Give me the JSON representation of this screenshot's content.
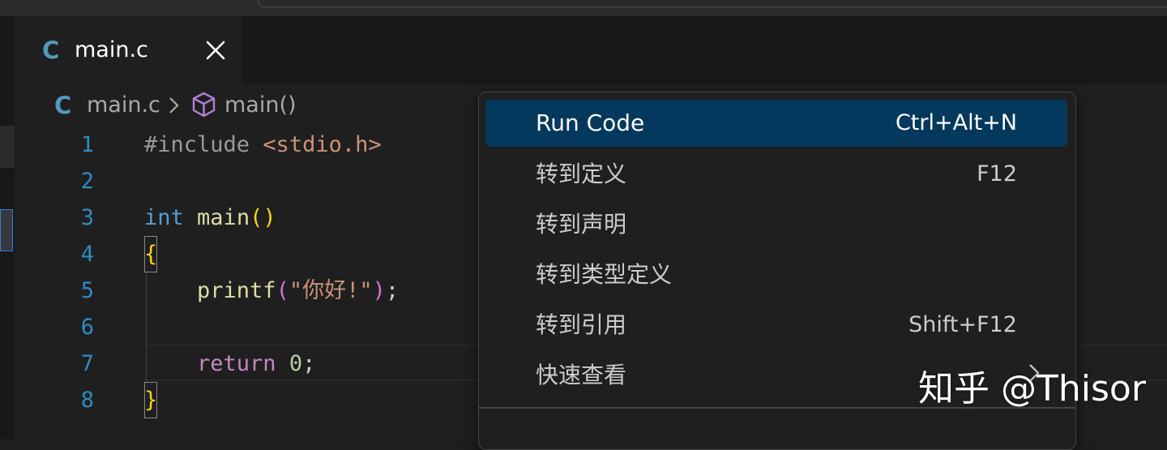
{
  "tab": {
    "icon_letter": "C",
    "title": "main.c",
    "close_glyph": "×"
  },
  "breadcrumb": {
    "icon_letter": "C",
    "file": "main.c",
    "symbol": "main()"
  },
  "editor": {
    "line_numbers": [
      "1",
      "2",
      "3",
      "4",
      "5",
      "6",
      "7",
      "8"
    ],
    "code": {
      "l1": {
        "directive": "#include",
        "space": " ",
        "header": "<stdio.h>"
      },
      "l3": {
        "type": "int",
        "space": " ",
        "fn": "main",
        "parens": "()"
      },
      "l4": {
        "brace_open": "{"
      },
      "l5": {
        "indent": "    ",
        "fn": "printf",
        "paren_open": "(",
        "string": "\"你好!\"",
        "paren_close": ")",
        "semi": ";"
      },
      "l7": {
        "indent": "    ",
        "keyword": "return",
        "space": " ",
        "number": "0",
        "semi": ";"
      },
      "l8": {
        "brace_close": "}"
      }
    }
  },
  "context_menu": {
    "items": [
      {
        "label": "Run Code",
        "shortcut": "Ctrl+Alt+N"
      },
      {
        "label": "转到定义",
        "shortcut": "F12"
      },
      {
        "label": "转到声明",
        "shortcut": ""
      },
      {
        "label": "转到类型定义",
        "shortcut": ""
      },
      {
        "label": "转到引用",
        "shortcut": "Shift+F12"
      },
      {
        "label": "快速查看",
        "shortcut": ""
      }
    ]
  },
  "watermark": "知乎 @Thisor",
  "colors": {
    "accent_selection": "#04395e",
    "line_number": "#2b8cc4",
    "c_icon": "#519aba"
  }
}
